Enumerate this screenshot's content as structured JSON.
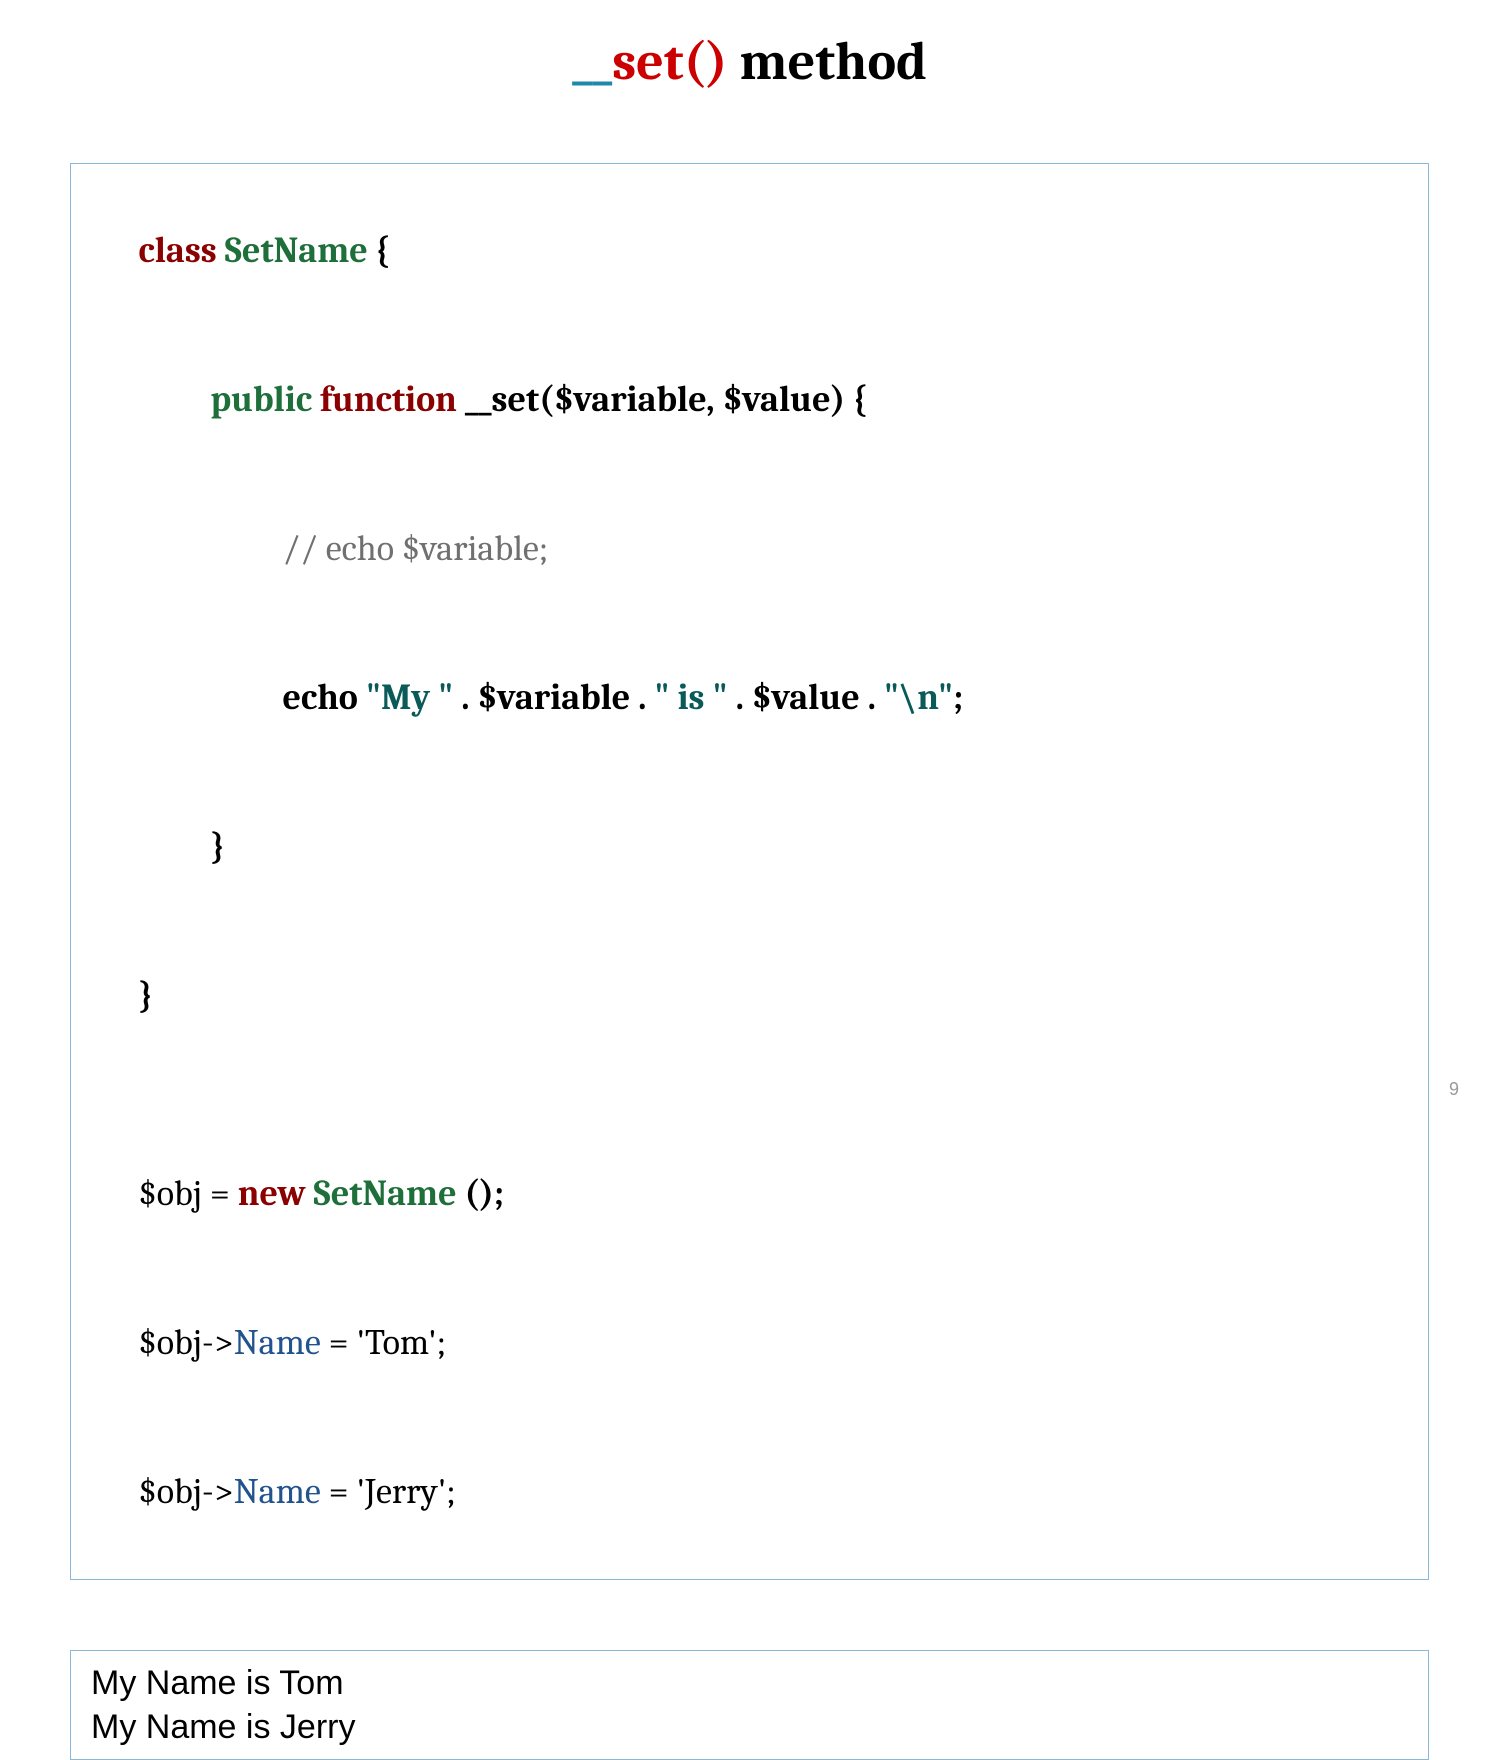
{
  "title": {
    "underscore": "__",
    "set": "set()",
    "rest": " method"
  },
  "code": {
    "l1": {
      "class": "class ",
      "name": "SetName ",
      "brace": "{"
    },
    "l2": {
      "public": "public ",
      "function": "function ",
      "sig": "__set($variable, $value) {"
    },
    "l3": {
      "comment": "// echo $variable;"
    },
    "l4": {
      "echo": "echo ",
      "s1": "\"My \"",
      "d1": " . $variable . ",
      "s2": "\" is \"",
      "d2": " . $value . ",
      "s3": "\"\\n\"",
      "semi": ";"
    },
    "l5": {
      "brace": "}"
    },
    "l6": {
      "brace": "}"
    },
    "l7": {
      "a": "$obj = ",
      "new": "new ",
      "name": "SetName ",
      "b": "();"
    },
    "l8": {
      "a": "$obj->",
      "prop": "Name",
      "b": " = 'Tom';"
    },
    "l9": {
      "a": "$obj->",
      "prop": "Name",
      "b": " = 'Jerry';"
    }
  },
  "output": {
    "line1": "My Name is Tom",
    "line2": "My Name is Jerry"
  },
  "pagenum": "9"
}
